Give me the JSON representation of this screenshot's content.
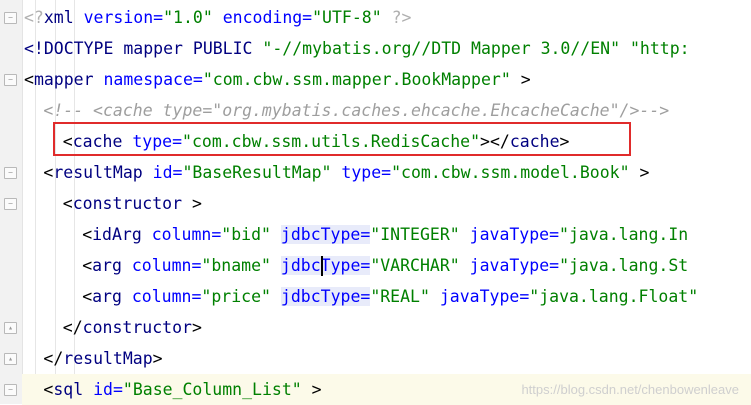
{
  "editor": {
    "language": "XML",
    "lines": [
      {
        "indent": 0,
        "fold": "-",
        "tokens": [
          {
            "text": "<?",
            "color": "#b0b0b0"
          },
          {
            "text": "xml ",
            "color": "#000080"
          },
          {
            "text": "version=",
            "color": "#0000ff"
          },
          {
            "text": "\"1.0\"",
            "color": "#008000"
          },
          {
            "text": " encoding=",
            "color": "#0000ff"
          },
          {
            "text": "\"UTF-8\"",
            "color": "#008000"
          },
          {
            "text": " ?>",
            "color": "#b0b0b0"
          }
        ]
      },
      {
        "indent": 0,
        "tokens": [
          {
            "text": "<!DOCTYPE ",
            "color": "#000080"
          },
          {
            "text": "mapper PUBLIC ",
            "color": "#000080"
          },
          {
            "text": "\"-//mybatis.org//DTD Mapper 3.0//EN\"",
            "color": "#008000"
          },
          {
            "text": " \"http:",
            "color": "#008000"
          }
        ]
      },
      {
        "indent": 0,
        "fold": "-",
        "tokens": [
          {
            "text": "<",
            "color": "#000000"
          },
          {
            "text": "mapper ",
            "color": "#000080"
          },
          {
            "text": "namespace=",
            "color": "#0000ff"
          },
          {
            "text": "\"com.cbw.ssm.mapper.BookMapper\"",
            "color": "#008000"
          },
          {
            "text": " >",
            "color": "#000000"
          }
        ]
      },
      {
        "indent": 1,
        "tokens": [
          {
            "text": "<!-- <cache type=\"org.mybatis.caches.ehcache.EhcacheCache\"/>-->",
            "color": "#9e9e9e",
            "italic": true
          }
        ]
      },
      {
        "indent": 2,
        "tokens": [
          {
            "text": "<",
            "color": "#000000"
          },
          {
            "text": "cache ",
            "color": "#000080"
          },
          {
            "text": "type=",
            "color": "#0000ff"
          },
          {
            "text": "\"com.cbw.ssm.utils.RedisCache\"",
            "color": "#008000"
          },
          {
            "text": "></",
            "color": "#000000"
          },
          {
            "text": "cache",
            "color": "#000080"
          },
          {
            "text": ">",
            "color": "#000000"
          }
        ]
      },
      {
        "indent": 1,
        "fold": "-",
        "tokens": [
          {
            "text": "<",
            "color": "#000000"
          },
          {
            "text": "resultMap ",
            "color": "#000080"
          },
          {
            "text": "id=",
            "color": "#0000ff"
          },
          {
            "text": "\"BaseResultMap\"",
            "color": "#008000"
          },
          {
            "text": " type=",
            "color": "#0000ff"
          },
          {
            "text": "\"com.cbw.ssm.model.Book\"",
            "color": "#008000"
          },
          {
            "text": " >",
            "color": "#000000"
          }
        ]
      },
      {
        "indent": 2,
        "fold": "-",
        "tokens": [
          {
            "text": "<",
            "color": "#000000"
          },
          {
            "text": "constructor",
            "color": "#000080"
          },
          {
            "text": " >",
            "color": "#000000"
          }
        ]
      },
      {
        "indent": 3,
        "tokens": [
          {
            "text": "<",
            "color": "#000000"
          },
          {
            "text": "idArg ",
            "color": "#000080"
          },
          {
            "text": "column=",
            "color": "#0000ff"
          },
          {
            "text": "\"bid\"",
            "color": "#008000"
          },
          {
            "text": " ",
            "color": "#000000"
          },
          {
            "text": "jdbcType=",
            "color": "#0000ff",
            "ident": true
          },
          {
            "text": "\"INTEGER\"",
            "color": "#008000"
          },
          {
            "text": " javaType=",
            "color": "#0000ff"
          },
          {
            "text": "\"java.lang.In",
            "color": "#008000"
          }
        ]
      },
      {
        "indent": 3,
        "tokens": [
          {
            "text": "<",
            "color": "#000000"
          },
          {
            "text": "arg ",
            "color": "#000080"
          },
          {
            "text": "column=",
            "color": "#0000ff"
          },
          {
            "text": "\"bname\"",
            "color": "#008000"
          },
          {
            "text": " ",
            "color": "#000000"
          },
          {
            "text": "jdbcType=",
            "color": "#0000ff",
            "ident": true,
            "caretAfter": 4
          },
          {
            "text": "\"VARCHAR\"",
            "color": "#008000"
          },
          {
            "text": " javaType=",
            "color": "#0000ff"
          },
          {
            "text": "\"java.lang.St",
            "color": "#008000"
          }
        ]
      },
      {
        "indent": 3,
        "tokens": [
          {
            "text": "<",
            "color": "#000000"
          },
          {
            "text": "arg ",
            "color": "#000080"
          },
          {
            "text": "column=",
            "color": "#0000ff"
          },
          {
            "text": "\"price\"",
            "color": "#008000"
          },
          {
            "text": " ",
            "color": "#000000"
          },
          {
            "text": "jdbcType=",
            "color": "#0000ff",
            "ident": true
          },
          {
            "text": "\"REAL\"",
            "color": "#008000"
          },
          {
            "text": " javaType=",
            "color": "#0000ff"
          },
          {
            "text": "\"java.lang.Float\"",
            "color": "#008000"
          }
        ]
      },
      {
        "indent": 2,
        "fold": "^",
        "tokens": [
          {
            "text": "</",
            "color": "#000000"
          },
          {
            "text": "constructor",
            "color": "#000080"
          },
          {
            "text": ">",
            "color": "#000000"
          }
        ]
      },
      {
        "indent": 1,
        "fold": "^",
        "tokens": [
          {
            "text": "</",
            "color": "#000000"
          },
          {
            "text": "resultMap",
            "color": "#000080"
          },
          {
            "text": ">",
            "color": "#000000"
          }
        ]
      },
      {
        "indent": 1,
        "fold": "-",
        "highlighted": true,
        "tokens": [
          {
            "text": "<",
            "color": "#000000"
          },
          {
            "text": "sql ",
            "color": "#000080"
          },
          {
            "text": "id=",
            "color": "#0000ff"
          },
          {
            "text": "\"Base_Column_List\"",
            "color": "#008000"
          },
          {
            "text": " >",
            "color": "#000000"
          }
        ]
      }
    ]
  },
  "watermark": "https://blog.csdn.net/chenbowenleave",
  "colors": {
    "tag": "#000080",
    "attribute": "#0000ff",
    "value": "#008000",
    "comment": "#9e9e9e",
    "highlight_border": "#e02b2b"
  }
}
